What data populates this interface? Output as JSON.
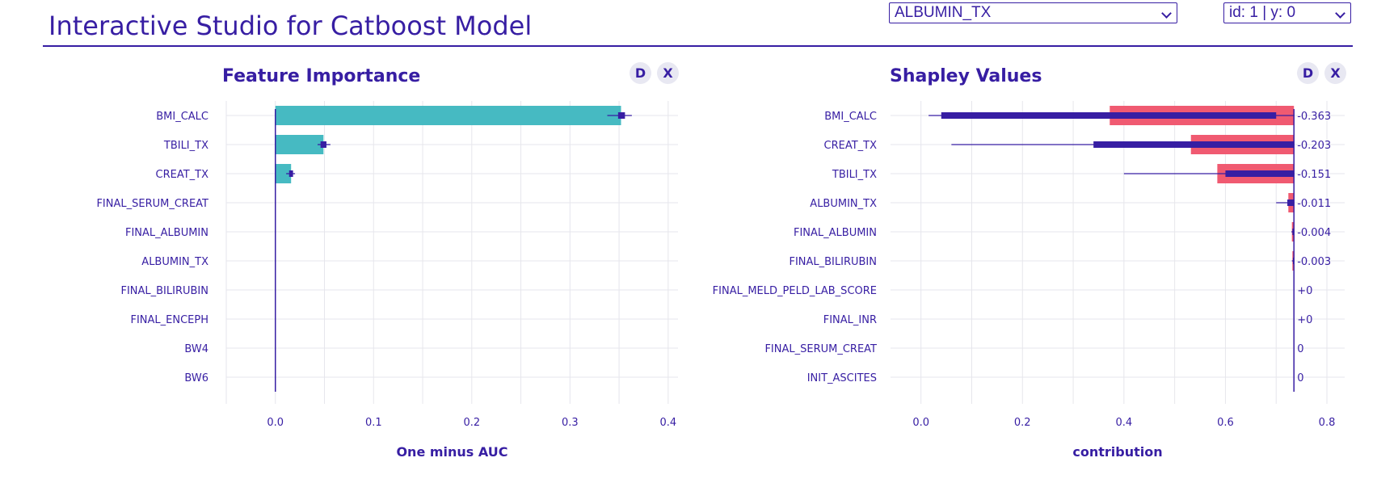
{
  "header": {
    "title": "Interactive Studio for Catboost Model",
    "variable_select": "ALBUMIN_TX",
    "observation_select": "id: 1 | y: 0"
  },
  "colors": {
    "text": "#371ea3",
    "teal": "#46bac2",
    "red": "#f05a71",
    "grid": "#e6e6ec",
    "button_bg": "#e8e8f2"
  },
  "panels": {
    "feature_importance": {
      "title": "Feature Importance",
      "button_d": "D",
      "button_x": "X"
    },
    "shapley": {
      "title": "Shapley Values",
      "button_d": "D",
      "button_x": "X"
    }
  },
  "chart_data": [
    {
      "type": "bar",
      "orientation": "horizontal",
      "title": "Feature Importance",
      "xlabel": "One minus AUC",
      "ylabel": "",
      "xlim": [
        -0.05,
        0.41
      ],
      "xticks": [
        0.0,
        0.1,
        0.2,
        0.3,
        0.4
      ],
      "tick_labels": [
        "0.0",
        "0.1",
        "0.2",
        "0.3",
        "0.4"
      ],
      "grid": true,
      "categories": [
        "BMI_CALC",
        "TBILI_TX",
        "CREAT_TX",
        "FINAL_SERUM_CREAT",
        "FINAL_ALBUMIN",
        "ALBUMIN_TX",
        "FINAL_BILIRUBIN",
        "FINAL_ENCEPH",
        "BW4",
        "BW6"
      ],
      "values": [
        0.352,
        0.049,
        0.016,
        0,
        0,
        0,
        0,
        0,
        0,
        0
      ],
      "boxplot_min": [
        0.338,
        0.043,
        0.011,
        0,
        0,
        0,
        0,
        0,
        0,
        0
      ],
      "boxplot_q1": [
        0.349,
        0.046,
        0.014,
        0,
        0,
        0,
        0,
        0,
        0,
        0
      ],
      "boxplot_q3": [
        0.356,
        0.052,
        0.018,
        0,
        0,
        0,
        0,
        0,
        0,
        0
      ],
      "boxplot_max": [
        0.363,
        0.056,
        0.02,
        0,
        0,
        0,
        0,
        0,
        0,
        0
      ]
    },
    {
      "type": "bar",
      "orientation": "horizontal",
      "title": "Shapley Values",
      "xlabel": "contribution",
      "ylabel": "",
      "xlim": [
        -0.06,
        0.835
      ],
      "xticks": [
        0.0,
        0.2,
        0.4,
        0.6,
        0.8
      ],
      "tick_labels": [
        "0.0",
        "0.2",
        "0.4",
        "0.6",
        "0.8"
      ],
      "baseline": 0.735,
      "grid": true,
      "categories": [
        "BMI_CALC",
        "CREAT_TX",
        "TBILI_TX",
        "ALBUMIN_TX",
        "FINAL_ALBUMIN",
        "FINAL_BILIRUBIN",
        "FINAL_MELD_PELD_LAB_SCORE",
        "FINAL_INR",
        "FINAL_SERUM_CREAT",
        "INIT_ASCITES"
      ],
      "values": [
        -0.363,
        -0.203,
        -0.151,
        -0.011,
        -0.004,
        -0.003,
        0,
        0,
        0,
        0
      ],
      "value_labels": [
        "-0.363",
        "-0.203",
        "-0.151",
        "-0.011",
        "-0.004",
        "-0.003",
        "+0",
        "+0",
        "0",
        "0"
      ],
      "boxplot_min": [
        0.015,
        0.06,
        0.4,
        0.7,
        0.73,
        0.731,
        0.735,
        0.735,
        0.735,
        0.735
      ],
      "boxplot_q1": [
        0.04,
        0.34,
        0.6,
        0.722,
        0.732,
        0.733,
        0.735,
        0.735,
        0.735,
        0.735
      ],
      "boxplot_q3": [
        0.7,
        0.735,
        0.735,
        0.735,
        0.735,
        0.735,
        0.735,
        0.735,
        0.735,
        0.735
      ],
      "boxplot_max": [
        0.735,
        0.735,
        0.735,
        0.735,
        0.735,
        0.735,
        0.735,
        0.735,
        0.735,
        0.735
      ]
    }
  ]
}
